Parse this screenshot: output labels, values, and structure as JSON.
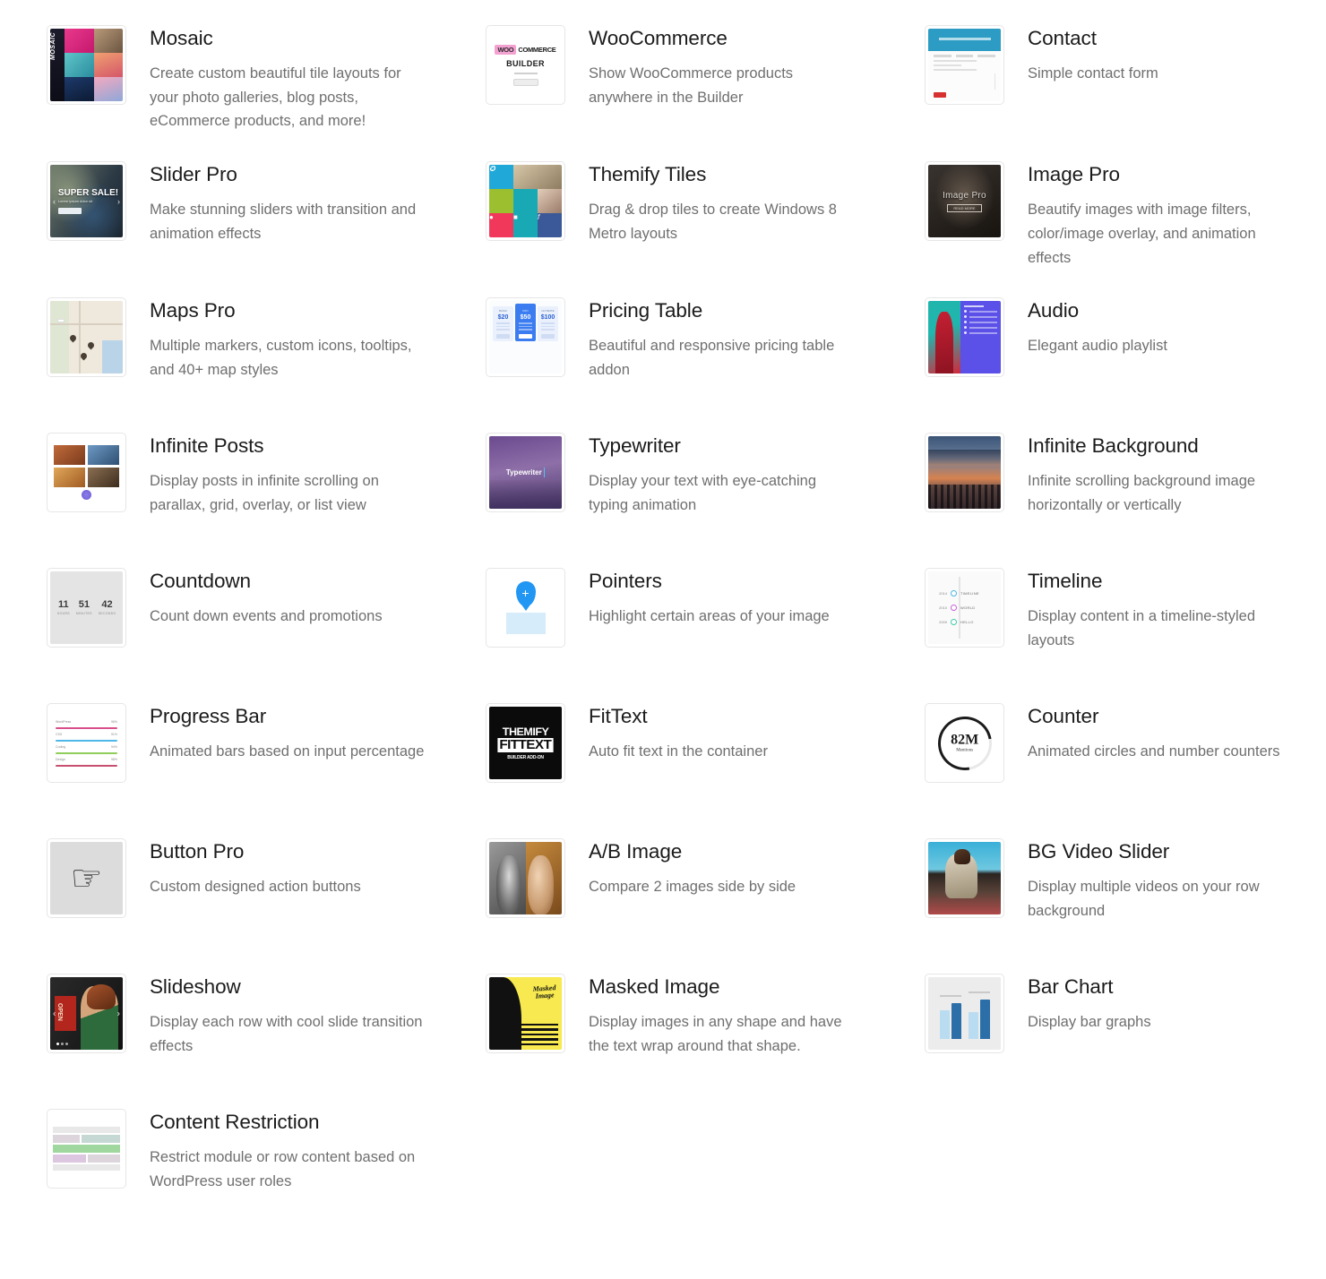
{
  "addons": [
    {
      "title": "Mosaic",
      "description": "Create custom beautiful tile layouts for your photo galleries, blog posts, eCommerce products, and more!",
      "thumb": "mosaic-thumbnail",
      "thumb_text": {
        "label": "MOSAIC"
      }
    },
    {
      "title": "WooCommerce",
      "description": "Show WooCommerce products anywhere in the Builder",
      "thumb": "woocommerce-thumbnail",
      "thumb_text": {
        "badge": "WOO",
        "word": "COMMERCE",
        "builder": "BUILDER"
      }
    },
    {
      "title": "Contact",
      "description": "Simple contact form",
      "thumb": "contact-thumbnail"
    },
    {
      "title": "Slider Pro",
      "description": "Make stunning sliders with transition and animation effects",
      "thumb": "slider-pro-thumbnail",
      "thumb_text": {
        "headline": "SUPER SALE!"
      }
    },
    {
      "title": "Themify Tiles",
      "description": "Drag & drop tiles to create Windows 8 Metro layouts",
      "thumb": "themify-tiles-thumbnail"
    },
    {
      "title": "Image Pro",
      "description": "Beautify images with image filters, color/image overlay, and animation effects",
      "thumb": "image-pro-thumbnail",
      "thumb_text": {
        "label": "Image Pro",
        "button": "READ MORE"
      }
    },
    {
      "title": "Maps Pro",
      "description": "Multiple markers, custom icons, tooltips, and 40+ map styles",
      "thumb": "maps-pro-thumbnail"
    },
    {
      "title": "Pricing Table",
      "description": "Beautiful and responsive pricing table addon",
      "thumb": "pricing-table-thumbnail",
      "prices": [
        "$20",
        "$50",
        "$100"
      ],
      "plans": [
        "BASIC",
        "PRO",
        "ULTIMATE"
      ]
    },
    {
      "title": "Audio",
      "description": "Elegant audio playlist",
      "thumb": "audio-thumbnail"
    },
    {
      "title": "Infinite Posts",
      "description": "Display posts in infinite scrolling on parallax, grid, overlay, or list view",
      "thumb": "infinite-posts-thumbnail"
    },
    {
      "title": "Typewriter",
      "description": "Display your text with eye-catching typing animation",
      "thumb": "typewriter-thumbnail",
      "thumb_text": {
        "label": "Typewriter"
      }
    },
    {
      "title": "Infinite Background",
      "description": "Infinite scrolling background image horizontally or vertically",
      "thumb": "infinite-background-thumbnail"
    },
    {
      "title": "Countdown",
      "description": "Count down events and promotions",
      "thumb": "countdown-thumbnail",
      "units": [
        {
          "value": "11",
          "label": "HOURS"
        },
        {
          "value": "51",
          "label": "MINUTES"
        },
        {
          "value": "42",
          "label": "SECONDS"
        }
      ]
    },
    {
      "title": "Pointers",
      "description": "Highlight certain areas of your image",
      "thumb": "pointers-thumbnail"
    },
    {
      "title": "Timeline",
      "description": "Display content in a timeline-styled layouts",
      "thumb": "timeline-thumbnail",
      "entries": [
        {
          "year": "2014",
          "label": "TIMELINE"
        },
        {
          "year": "2010",
          "label": "WORLD"
        },
        {
          "year": "2009",
          "label": "HELLO"
        }
      ]
    },
    {
      "title": "Progress Bar",
      "description": "Animated bars based on input percentage",
      "thumb": "progress-bar-thumbnail",
      "bars": [
        {
          "label": "WordPress",
          "value": "96%"
        },
        {
          "label": "CSS",
          "value": "91%"
        },
        {
          "label": "Coding",
          "value": "94%"
        },
        {
          "label": "Design",
          "value": "98%"
        }
      ]
    },
    {
      "title": "FitText",
      "description": "Auto fit text in the container",
      "thumb": "fittext-thumbnail",
      "thumb_text": {
        "line1": "THEMIFY",
        "line2": "FITTEXT",
        "line3": "BUILDER ADD-ON"
      }
    },
    {
      "title": "Counter",
      "description": "Animated circles and number counters",
      "thumb": "counter-thumbnail",
      "thumb_text": {
        "number": "82M",
        "label": "Mentions"
      }
    },
    {
      "title": "Button Pro",
      "description": "Custom designed action buttons",
      "thumb": "button-pro-thumbnail"
    },
    {
      "title": "A/B Image",
      "description": "Compare 2 images side by side",
      "thumb": "ab-image-thumbnail"
    },
    {
      "title": "BG Video Slider",
      "description": "Display multiple videos on your row background",
      "thumb": "bg-video-slider-thumbnail"
    },
    {
      "title": "Slideshow",
      "description": "Display each row with cool slide transition effects",
      "thumb": "slideshow-thumbnail",
      "thumb_text": {
        "sign": "OPEN"
      }
    },
    {
      "title": "Masked Image",
      "description": "Display images in any shape and have the text wrap around that shape.",
      "thumb": "masked-image-thumbnail",
      "thumb_text": {
        "line1": "Masked",
        "line2": "Image"
      }
    },
    {
      "title": "Bar Chart",
      "description": "Display bar graphs",
      "thumb": "bar-chart-thumbnail"
    },
    {
      "title": "Content Restriction",
      "description": "Restrict module or row content based on WordPress user roles",
      "thumb": "content-restriction-thumbnail"
    }
  ],
  "colors": {
    "title": "#1b1b1b",
    "description": "#6f6f6f",
    "thumb_border": "#e6e6e6",
    "page_background": "#ffffff"
  }
}
